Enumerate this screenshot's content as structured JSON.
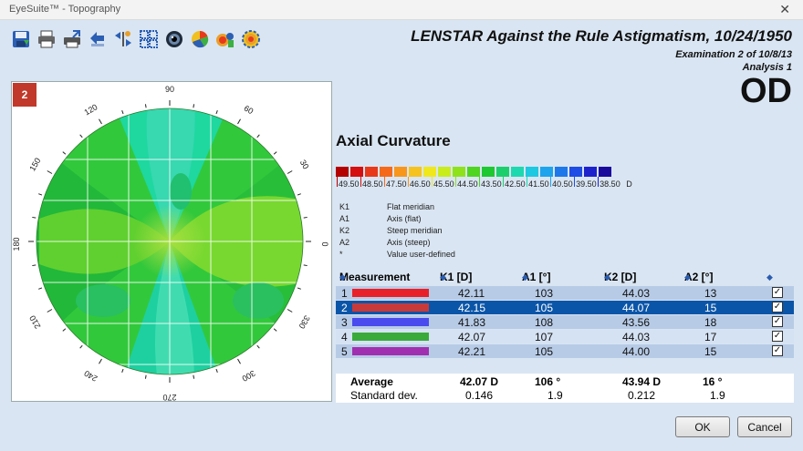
{
  "window": {
    "title": "EyeSuite™ - Topography",
    "close_glyph": "✕"
  },
  "toolbar": {
    "icons": [
      "save-icon",
      "print-icon",
      "print-preview-icon",
      "back-icon",
      "compare-icon",
      "multi-view-icon",
      "eye-image-icon",
      "color-scale-icon",
      "keratoconus-icon",
      "settings-icon"
    ]
  },
  "header": {
    "title": "LENSTAR Against the Rule Astigmatism,  10/24/1950",
    "examination": "Examination 2 of 10/8/13",
    "analysis": "Analysis 1",
    "eye": "OD"
  },
  "map": {
    "number": "2",
    "axis_labels": [
      "90",
      "60",
      "30",
      "0",
      "330",
      "300",
      "270",
      "240",
      "210",
      "180",
      "150",
      "120"
    ]
  },
  "section": {
    "title": "Axial Curvature"
  },
  "colorbar": {
    "colors": [
      "#b30000",
      "#d41010",
      "#e83a1a",
      "#f46a1a",
      "#f8961c",
      "#f6c21e",
      "#f0e81c",
      "#c8ec1c",
      "#8ee21c",
      "#4fd420",
      "#1ec830",
      "#1ccf6c",
      "#1ed8b0",
      "#1ec8e0",
      "#1ea4ec",
      "#1e78ea",
      "#1e4ce4",
      "#1e22cc",
      "#1a0a9c"
    ],
    "labels": [
      "49.50",
      "48.50",
      "47.50",
      "46.50",
      "45.50",
      "44.50",
      "43.50",
      "42.50",
      "41.50",
      "40.50",
      "39.50",
      "38.50"
    ],
    "unit": "D"
  },
  "legend": [
    {
      "key": "K1",
      "desc": "Flat meridian"
    },
    {
      "key": "A1",
      "desc": "Axis (flat)"
    },
    {
      "key": "K2",
      "desc": "Steep meridian"
    },
    {
      "key": "A2",
      "desc": "Axis (steep)"
    },
    {
      "key": "*",
      "desc": "Value user-defined"
    }
  ],
  "table": {
    "headers": {
      "measurement": "Measurement",
      "k1": "K1 [D]",
      "a1": "A1 [°]",
      "k2": "K2 [D]",
      "a2": "A2 [°]"
    },
    "rows": [
      {
        "n": "1",
        "color": "#e8202a",
        "k1": "42.11",
        "a1": "103",
        "k2": "44.03",
        "a2": "13",
        "checked": "✓"
      },
      {
        "n": "2",
        "color": "#c83a3a",
        "k1": "42.15",
        "a1": "105",
        "k2": "44.07",
        "a2": "15",
        "checked": "✓"
      },
      {
        "n": "3",
        "color": "#4a4aee",
        "k1": "41.83",
        "a1": "108",
        "k2": "43.56",
        "a2": "18",
        "checked": "✓"
      },
      {
        "n": "4",
        "color": "#3aaa3a",
        "k1": "42.07",
        "a1": "107",
        "k2": "44.03",
        "a2": "17",
        "checked": "✓"
      },
      {
        "n": "5",
        "color": "#a030b0",
        "k1": "42.21",
        "a1": "105",
        "k2": "44.00",
        "a2": "15",
        "checked": "✓"
      }
    ]
  },
  "summary": {
    "average": {
      "label": "Average",
      "k1": "42.07 D",
      "a1": "106 °",
      "k2": "43.94 D",
      "a2": "16 °"
    },
    "stddev": {
      "label": "Standard dev.",
      "k1": "0.146",
      "a1": "1.9",
      "k2": "0.212",
      "a2": "1.9"
    }
  },
  "buttons": {
    "ok": "OK",
    "cancel": "Cancel"
  }
}
